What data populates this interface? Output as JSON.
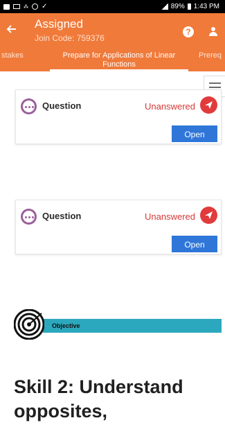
{
  "status_bar": {
    "right_text": "89%",
    "time": "1:43 PM"
  },
  "header": {
    "title": "Assigned",
    "join_code": "Join Code: 759376",
    "background_color": "#f07a3a"
  },
  "tabs": [
    {
      "label": "stakes"
    },
    {
      "label": "Prepare for Applications of Linear Functions"
    },
    {
      "label": "Prereq"
    }
  ],
  "cards": [
    {
      "label": "Question",
      "status": "Unanswered",
      "action": "Open"
    },
    {
      "label": "Question",
      "status": "Unanswered",
      "action": "Open"
    }
  ],
  "objective": {
    "label": "Objective",
    "color": "#2ba8bd"
  },
  "skill": {
    "heading": "Skill 2: Understand opposites,"
  },
  "colors": {
    "accent": "#f07a3a",
    "button": "#2f76d8",
    "status": "#d63838",
    "question_icon": "#9b5e9b"
  }
}
